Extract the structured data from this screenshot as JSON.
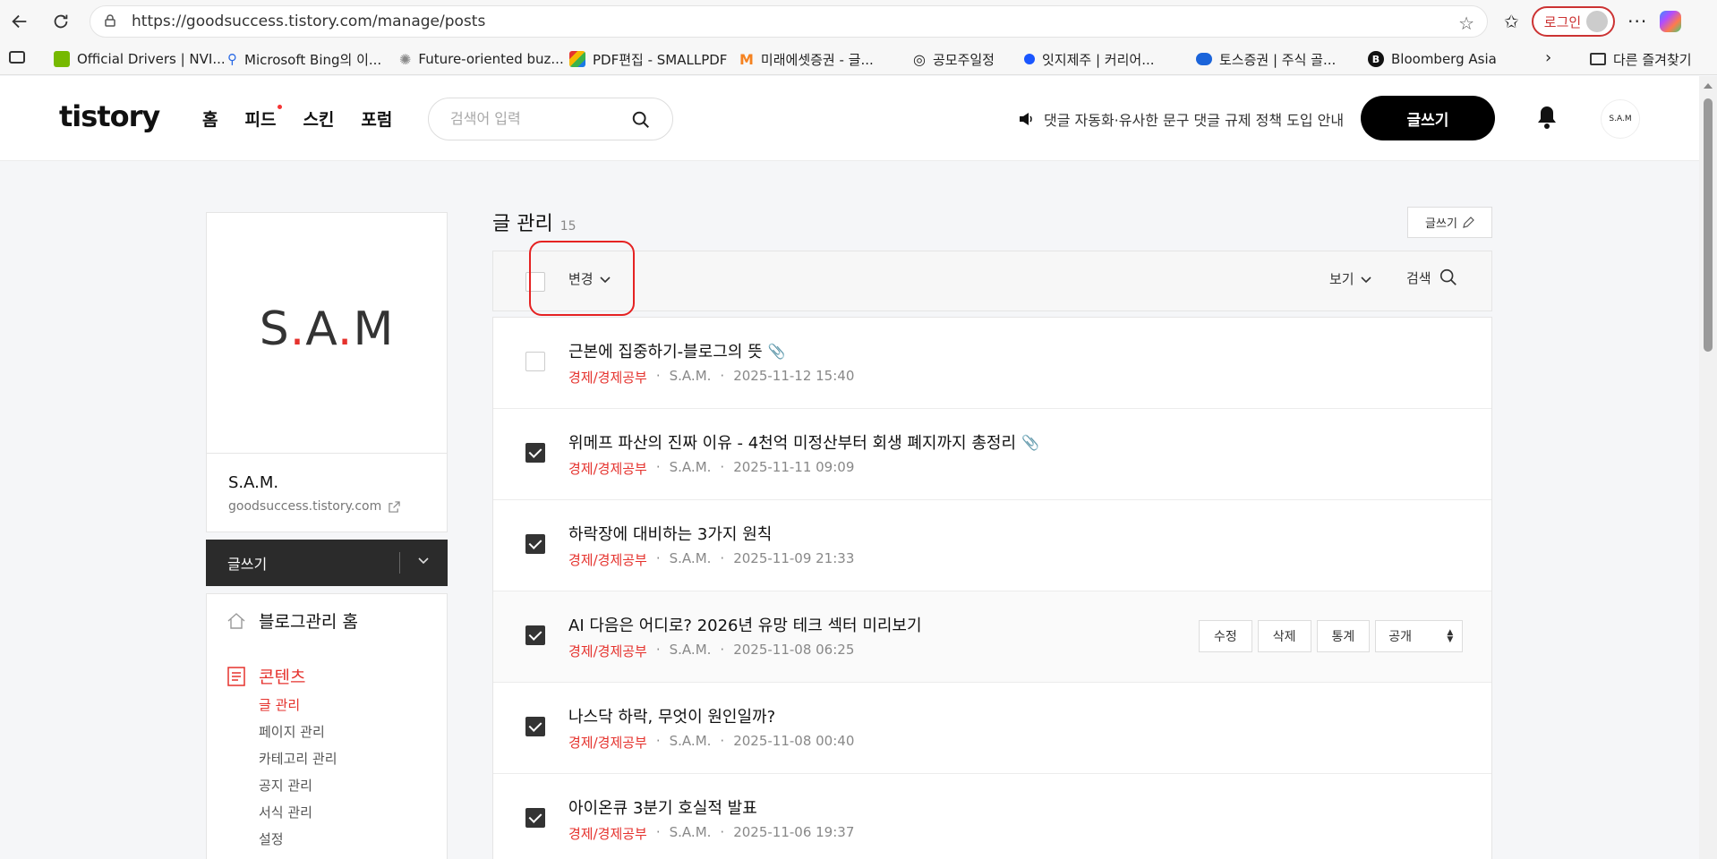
{
  "browser": {
    "url": "https://goodsuccess.tistory.com/manage/posts",
    "login_label": "로그인",
    "bookmarks": [
      {
        "label": "Official Drivers | NVI...",
        "icon": "nvidia-icon",
        "color": "#76b900"
      },
      {
        "label": "Microsoft Bing의 이...",
        "icon": "bing-search-icon",
        "color": "#2a6ae5"
      },
      {
        "label": "Future-oriented buz...",
        "icon": "openai-icon",
        "color": "#888888"
      },
      {
        "label": "PDF편집 - SMALLPDF",
        "icon": "smallpdf-icon",
        "color": "#e5322d"
      },
      {
        "label": "미래에셋증권 - 글...",
        "icon": "mirae-icon",
        "color": "#f58220"
      },
      {
        "label": "공모주일정",
        "icon": "globe-icon",
        "color": "#333333"
      },
      {
        "label": "잇지제주 | 커리어...",
        "icon": "chat-icon",
        "color": "#1a56ff"
      },
      {
        "label": "토스증권 | 주식 골...",
        "icon": "toss-icon",
        "color": "#1b64da"
      },
      {
        "label": "Bloomberg Asia",
        "icon": "bloomberg-icon",
        "color": "#111111"
      }
    ],
    "other_bookmarks": "다른 즐겨찾기"
  },
  "header": {
    "logo": "tistory",
    "nav": [
      "홈",
      "피드",
      "스킨",
      "포럼"
    ],
    "search_placeholder": "검색어 입력",
    "notice": "댓글 자동화·유사한 문구 댓글 규제 정책 도입 안내",
    "write_label": "글쓰기",
    "avatar_text": "S.A.M"
  },
  "sidebar": {
    "big_logo_parts": [
      "S",
      ".",
      "A",
      ".",
      "M"
    ],
    "blog_name": "S.A.M.",
    "blog_url": "goodsuccess.tistory.com",
    "write_label": "글쓰기",
    "home_label": "블로그관리 홈",
    "contents_label": "콘텐츠",
    "sub_items": [
      "글 관리",
      "페이지 관리",
      "카테고리 관리",
      "공지 관리",
      "서식 관리",
      "설정"
    ]
  },
  "main": {
    "title": "글 관리",
    "count": "15",
    "write_small": "글쓰기",
    "change_label": "변경",
    "view_label": "보기",
    "search_label": "검색",
    "accent_color": "#e5322d"
  },
  "posts": [
    {
      "title": "근본에 집중하기-블로그의 뜻",
      "category": "경제/경제공부",
      "author": "S.A.M.",
      "date": "2025-11-12 15:40",
      "checked": false,
      "clip": true
    },
    {
      "title": "위메프 파산의 진짜 이유 - 4천억 미정산부터 회생 폐지까지 총정리",
      "category": "경제/경제공부",
      "author": "S.A.M.",
      "date": "2025-11-11 09:09",
      "checked": true,
      "clip": true
    },
    {
      "title": "하락장에 대비하는 3가지 원칙",
      "category": "경제/경제공부",
      "author": "S.A.M.",
      "date": "2025-11-09 21:33",
      "checked": true,
      "clip": false
    },
    {
      "title": "AI 다음은 어디로? 2026년 유망 테크 섹터 미리보기",
      "category": "경제/경제공부",
      "author": "S.A.M.",
      "date": "2025-11-08 06:25",
      "checked": true,
      "clip": false
    },
    {
      "title": "나스닥 하락, 무엇이 원인일까?",
      "category": "경제/경제공부",
      "author": "S.A.M.",
      "date": "2025-11-08 00:40",
      "checked": true,
      "clip": false
    },
    {
      "title": "아이온큐 3분기 호실적 발표",
      "category": "경제/경제공부",
      "author": "S.A.M.",
      "date": "2025-11-06 19:37",
      "checked": true,
      "clip": false
    }
  ],
  "post_actions": {
    "edit": "수정",
    "delete": "삭제",
    "stats": "통계",
    "visibility": "공개"
  },
  "meta_sep": "·"
}
